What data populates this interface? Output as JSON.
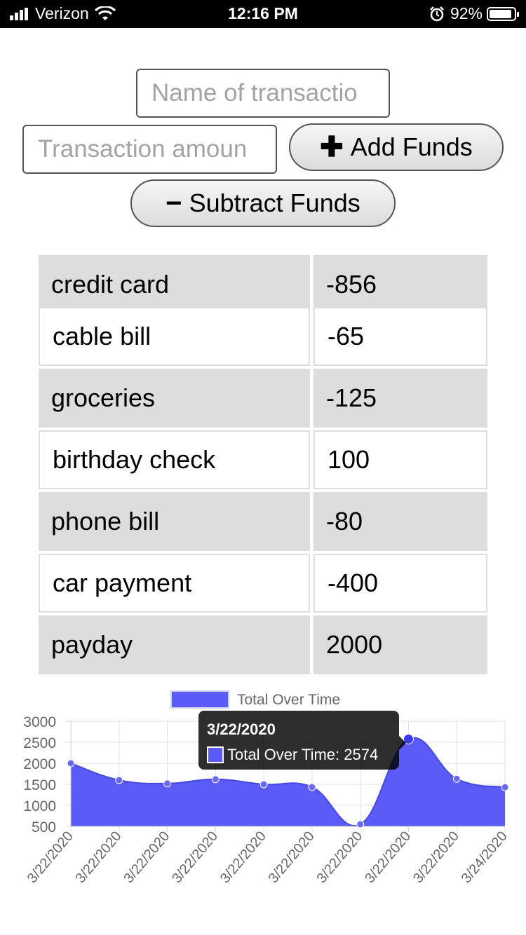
{
  "status_bar": {
    "carrier": "Verizon",
    "time": "12:16 PM",
    "battery": "92%",
    "battery_level": 0.92
  },
  "form": {
    "name_placeholder": "Name of transactio",
    "amount_placeholder": "Transaction amoun",
    "add_label": "Add Funds",
    "subtract_label": "Subtract Funds",
    "add_icon": "plus-icon",
    "subtract_icon": "minus-icon"
  },
  "transactions": [
    {
      "name": "credit card",
      "amount": "-856"
    },
    {
      "name": "cable bill",
      "amount": "-65"
    },
    {
      "name": "groceries",
      "amount": "-125"
    },
    {
      "name": "birthday check",
      "amount": "100"
    },
    {
      "name": "phone bill",
      "amount": "-80"
    },
    {
      "name": "car payment",
      "amount": "-400"
    },
    {
      "name": "payday",
      "amount": "2000"
    }
  ],
  "colors": {
    "series_fill": "#5b5bf7",
    "series_line": "#4848e0",
    "grid": "#e0e0e0",
    "row_shade": "#dddddd"
  },
  "chart_data": {
    "type": "area",
    "legend": "Total Over Time",
    "legend_position": "top-center",
    "x": [
      "3/22/2020",
      "3/22/2020",
      "3/22/2020",
      "3/22/2020",
      "3/22/2020",
      "3/22/2020",
      "3/22/2020",
      "3/22/2020",
      "3/22/2020",
      "3/24/2020"
    ],
    "series": [
      {
        "name": "Total Over Time",
        "values": [
          2000,
          1600,
          1520,
          1620,
          1500,
          1435,
          550,
          2574,
          1630,
          1430
        ]
      }
    ],
    "yticks": [
      3000,
      2500,
      2000,
      1500,
      1000,
      500
    ],
    "ylim": [
      500,
      3000
    ],
    "grid": true,
    "tooltip": {
      "title": "3/22/2020",
      "label": "Total Over Time: 2574",
      "index": 7
    }
  }
}
